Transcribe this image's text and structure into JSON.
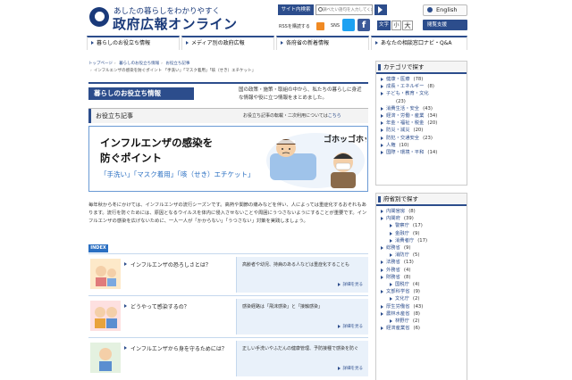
{
  "header": {
    "logo_sub": "あしたの暮らしをわかりやすく",
    "logo_title": "政府広報オンライン",
    "search_label": "サイト内検索",
    "search_placeholder": "調べたい語句を入力してください。",
    "language": "English",
    "rss_label": "RSSを購読する",
    "sns_label": "SNS",
    "facebook_glyph": "f",
    "font_size_label": "文字",
    "font_small": "小",
    "font_large": "大",
    "reader_label": "閲覧支援"
  },
  "nav": {
    "items": [
      {
        "label": "暮らしのお役立ち情報"
      },
      {
        "label": "メディア別の政府広報"
      },
      {
        "label": "各府省の新着情報"
      },
      {
        "label": "あなたの相談窓口ナビ・Q&A"
      }
    ]
  },
  "breadcrumb": {
    "items": [
      "トップページ",
      "暮らしのお役立ち情報",
      "お役立ち記事"
    ],
    "current": "インフルエンザの感染を防ぐポイント 「手洗い」「マスク着用」「咳（せき）エチケット」"
  },
  "section": {
    "title": "暮らしのお役立ち情報",
    "desc": "国の政策・施策・取組の中から、私たちの暮らしに身近な情報や役に立つ情報をまとめました。"
  },
  "articles": {
    "title": "お役立ち記事",
    "note": "お役立ち記事の転載・二次利用については",
    "note_link": "こちら"
  },
  "hero": {
    "title_line1": "インフルエンザの感染を",
    "title_line2": "防ぐポイント",
    "subtitle": "「手洗い」「マスク着用」「咳（せき）エチケット」",
    "illust_text": "ゴホッゴホッ"
  },
  "body_text": "毎年秋から冬にかけては、インフルエンザの流行シーズンです。高熱や関節の痛みなどを伴い、人によっては重症化するおそれもあります。流行を防ぐためには、原因となるウイルスを体内に侵入させないことや周囲にうつさないようにすることが重要です。インフルエンザの感染を広げないために、一人一人が「かからない」「うつさない」対策を実践しましょう。",
  "index": {
    "badge": "INDEX",
    "items": [
      {
        "question": "インフルエンザの恐ろしさとは？",
        "answer": "高齢者や幼児、持病のある人などは重症化することも",
        "more": "詳細を見る"
      },
      {
        "question": "どうやって感染するの？",
        "answer": "感染経路は「飛沫感染」と「接触感染」",
        "more": "詳細を見る"
      },
      {
        "question": "インフルエンザから身を守るためには？",
        "answer": "正しい手洗いやふだんの健康管理、予防接種で感染を防ぐ",
        "more": "詳細を見る"
      }
    ]
  },
  "sidebar": {
    "category_title": "カテゴリで探す",
    "categories": [
      {
        "label": "健康・医療",
        "count": "(78)"
      },
      {
        "label": "成長・エネルギー",
        "count": "(8)"
      },
      {
        "label": "子ども・教育・文化",
        "count": ""
      },
      {
        "label": "",
        "count": "(23)"
      },
      {
        "label": "消費生活・安全",
        "count": "(43)"
      },
      {
        "label": "経済・労働・産業",
        "count": "(34)"
      },
      {
        "label": "年金・福祉・税金",
        "count": "(20)"
      },
      {
        "label": "防災・減災",
        "count": "(20)"
      },
      {
        "label": "防犯・交通安全",
        "count": "(23)"
      },
      {
        "label": "人権",
        "count": "(10)"
      },
      {
        "label": "国際・環境・平和",
        "count": "(14)"
      }
    ],
    "ministry_title": "府省別で探す",
    "ministries": [
      {
        "label": "内閣官房",
        "count": "(8)",
        "sub": false
      },
      {
        "label": "内閣府",
        "count": "(39)",
        "sub": false
      },
      {
        "label": "警察庁",
        "count": "(17)",
        "sub": true
      },
      {
        "label": "金融庁",
        "count": "(9)",
        "sub": true
      },
      {
        "label": "消費者庁",
        "count": "(17)",
        "sub": true
      },
      {
        "label": "総務省",
        "count": "(9)",
        "sub": false
      },
      {
        "label": "消防庁",
        "count": "(5)",
        "sub": true
      },
      {
        "label": "法務省",
        "count": "(13)",
        "sub": false
      },
      {
        "label": "外務省",
        "count": "(4)",
        "sub": false
      },
      {
        "label": "財務省",
        "count": "(8)",
        "sub": false
      },
      {
        "label": "国税庁",
        "count": "(4)",
        "sub": true
      },
      {
        "label": "文部科学省",
        "count": "(9)",
        "sub": false
      },
      {
        "label": "文化庁",
        "count": "(2)",
        "sub": true
      },
      {
        "label": "厚生労働省",
        "count": "(43)",
        "sub": false
      },
      {
        "label": "農林水産省",
        "count": "(8)",
        "sub": false
      },
      {
        "label": "林野庁",
        "count": "(2)",
        "sub": true
      },
      {
        "label": "経済産業省",
        "count": "(6)",
        "sub": false
      }
    ]
  },
  "colors": {
    "brand_navy": "#2c4d8c",
    "link_blue": "#2a6fc2",
    "index_bg": "#e9f1fa"
  }
}
